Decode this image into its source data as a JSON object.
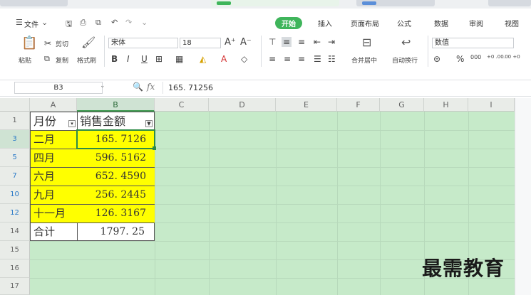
{
  "menu": {
    "file_label": "文件",
    "tabs": [
      {
        "label": "开始",
        "active": true
      },
      {
        "label": "插入"
      },
      {
        "label": "页面布局"
      },
      {
        "label": "公式"
      },
      {
        "label": "数据"
      },
      {
        "label": "审阅"
      },
      {
        "label": "视图"
      }
    ]
  },
  "ribbon": {
    "paste": "粘贴",
    "cut": "剪切",
    "copy": "复制",
    "format_painter": "格式刷",
    "font_name": "宋体",
    "font_size": "18",
    "merge_center": "合并居中",
    "wrap_text": "自动换行",
    "number_format": "数值",
    "percent": "%",
    "thousands": "000",
    "inc_decimal": "+0 .00",
    "dec_decimal": ".00 +0"
  },
  "formula_bar": {
    "name_box": "B3",
    "fx": "fx",
    "value": "165. 71256"
  },
  "grid": {
    "columns": [
      "A",
      "B",
      "C",
      "D",
      "E",
      "F",
      "G",
      "H",
      "I"
    ],
    "rows": [
      "1",
      "3",
      "5",
      "7",
      "10",
      "12",
      "14",
      "15",
      "16",
      "17"
    ],
    "header": {
      "a": "月份",
      "b": "销售金额"
    },
    "data": [
      {
        "row": "3",
        "a": "二月",
        "b": "165. 7126"
      },
      {
        "row": "5",
        "a": "四月",
        "b": "596. 5162"
      },
      {
        "row": "7",
        "a": "六月",
        "b": "652. 4590"
      },
      {
        "row": "10",
        "a": "九月",
        "b": "256. 2445"
      },
      {
        "row": "12",
        "a": "十一月",
        "b": "126. 3167"
      }
    ],
    "total": {
      "row": "14",
      "a": "合计",
      "b": "1797. 25"
    }
  },
  "watermark": "最需教育",
  "colors": {
    "accent": "#3fb55b",
    "sheet_bg": "#c6eac9",
    "highlight": "#ffff00"
  }
}
